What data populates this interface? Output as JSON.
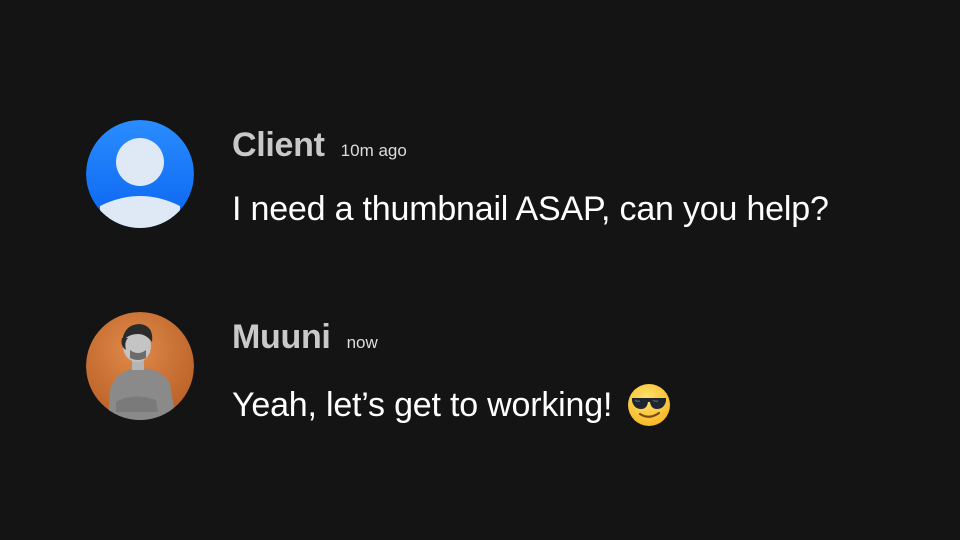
{
  "messages": [
    {
      "author": "Client",
      "time": "10m ago",
      "text": "I need a thumbnail ASAP, can you help?",
      "avatar": "default-user-avatar",
      "avatar_color": "#1a7cff"
    },
    {
      "author": "Muuni",
      "time": "now",
      "text": "Yeah, let’s get to working!",
      "avatar": "user-photo-avatar",
      "avatar_color": "#d57a3e",
      "emoji": "smiling-face-with-sunglasses"
    }
  ],
  "colors": {
    "background": "#141414",
    "author": "#c9c9c9",
    "text": "#ffffff"
  }
}
